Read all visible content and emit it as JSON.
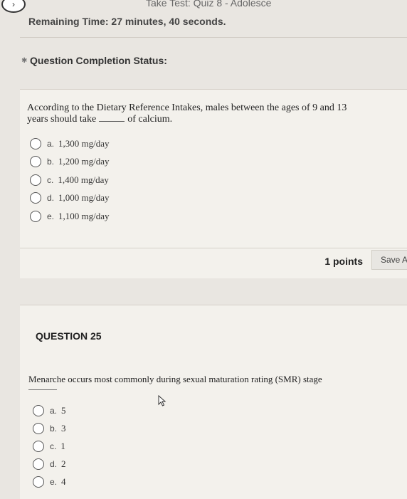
{
  "header": {
    "page_title": "Take Test: Quiz 8 - Adolesce",
    "timer_text": "Remaining Time: 27 minutes, 40 seconds."
  },
  "status": {
    "label": "Question Completion Status:"
  },
  "question24": {
    "text_before": "According to the Dietary Reference Intakes, males between the ages of 9 and 13 years should take",
    "text_after": "of calcium.",
    "options": [
      {
        "letter": "a.",
        "text": "1,300 mg/day"
      },
      {
        "letter": "b.",
        "text": "1,200 mg/day"
      },
      {
        "letter": "c.",
        "text": "1,400 mg/day"
      },
      {
        "letter": "d.",
        "text": "1,000 mg/day"
      },
      {
        "letter": "e.",
        "text": "1,100 mg/day"
      }
    ],
    "points": "1 points",
    "save_label": "Save A"
  },
  "question25": {
    "number_label": "QUESTION 25",
    "text": "Menarche occurs most commonly during sexual maturation rating (SMR) stage",
    "options": [
      {
        "letter": "a.",
        "text": "5"
      },
      {
        "letter": "b.",
        "text": "3"
      },
      {
        "letter": "c.",
        "text": "1"
      },
      {
        "letter": "d.",
        "text": "2"
      },
      {
        "letter": "e.",
        "text": "4"
      }
    ]
  }
}
